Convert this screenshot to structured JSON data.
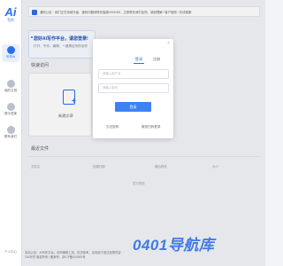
{
  "app": {
    "logo_mark": "Ai",
    "logo_sub": "写作"
  },
  "sidebar": {
    "items": [
      {
        "label": "写作Ai",
        "active": true
      },
      {
        "label": "我的文档",
        "active": false
      },
      {
        "label": "提示语库",
        "active": false
      },
      {
        "label": "联系我们",
        "active": false
      }
    ],
    "bottom": "个人中心"
  },
  "notice": "通知公告：我们正在持续升级，遇到问题请联系客服4001000，立即联系我们反馈，感谢理解 / 客户服务 / 在线客服",
  "welcome": {
    "title": "您好AI写作平台，请您登录!",
    "subtitle": "打开、写作、编辑，一键搞定你的创作"
  },
  "sections": {
    "quick": "快速访问",
    "new_doc": "新建文章",
    "recent": "最近文件"
  },
  "recent_columns": [
    "文件名",
    "创建日期",
    "最后修改",
    "大小"
  ],
  "recent_empty": "暂无数据",
  "modal": {
    "close_icon": "close-icon",
    "tab_login": "登录",
    "tab_register": "注册",
    "username_placeholder": "请输入用户名",
    "password_placeholder": "请输入密码",
    "submit": "登录",
    "forgot": "忘记密码",
    "wechat": "微信扫码登录"
  },
  "footer": {
    "line1": "本站公告：AI写作平台，创作辅助工具，仅供参考，请勿用于违法违规内容",
    "line2": "©AI写作 版权所有 | 备案号：京ICP备000000号"
  },
  "watermark": "0401导航库",
  "colors": {
    "accent": "#2a6ef0",
    "button": "#3b82f6"
  }
}
